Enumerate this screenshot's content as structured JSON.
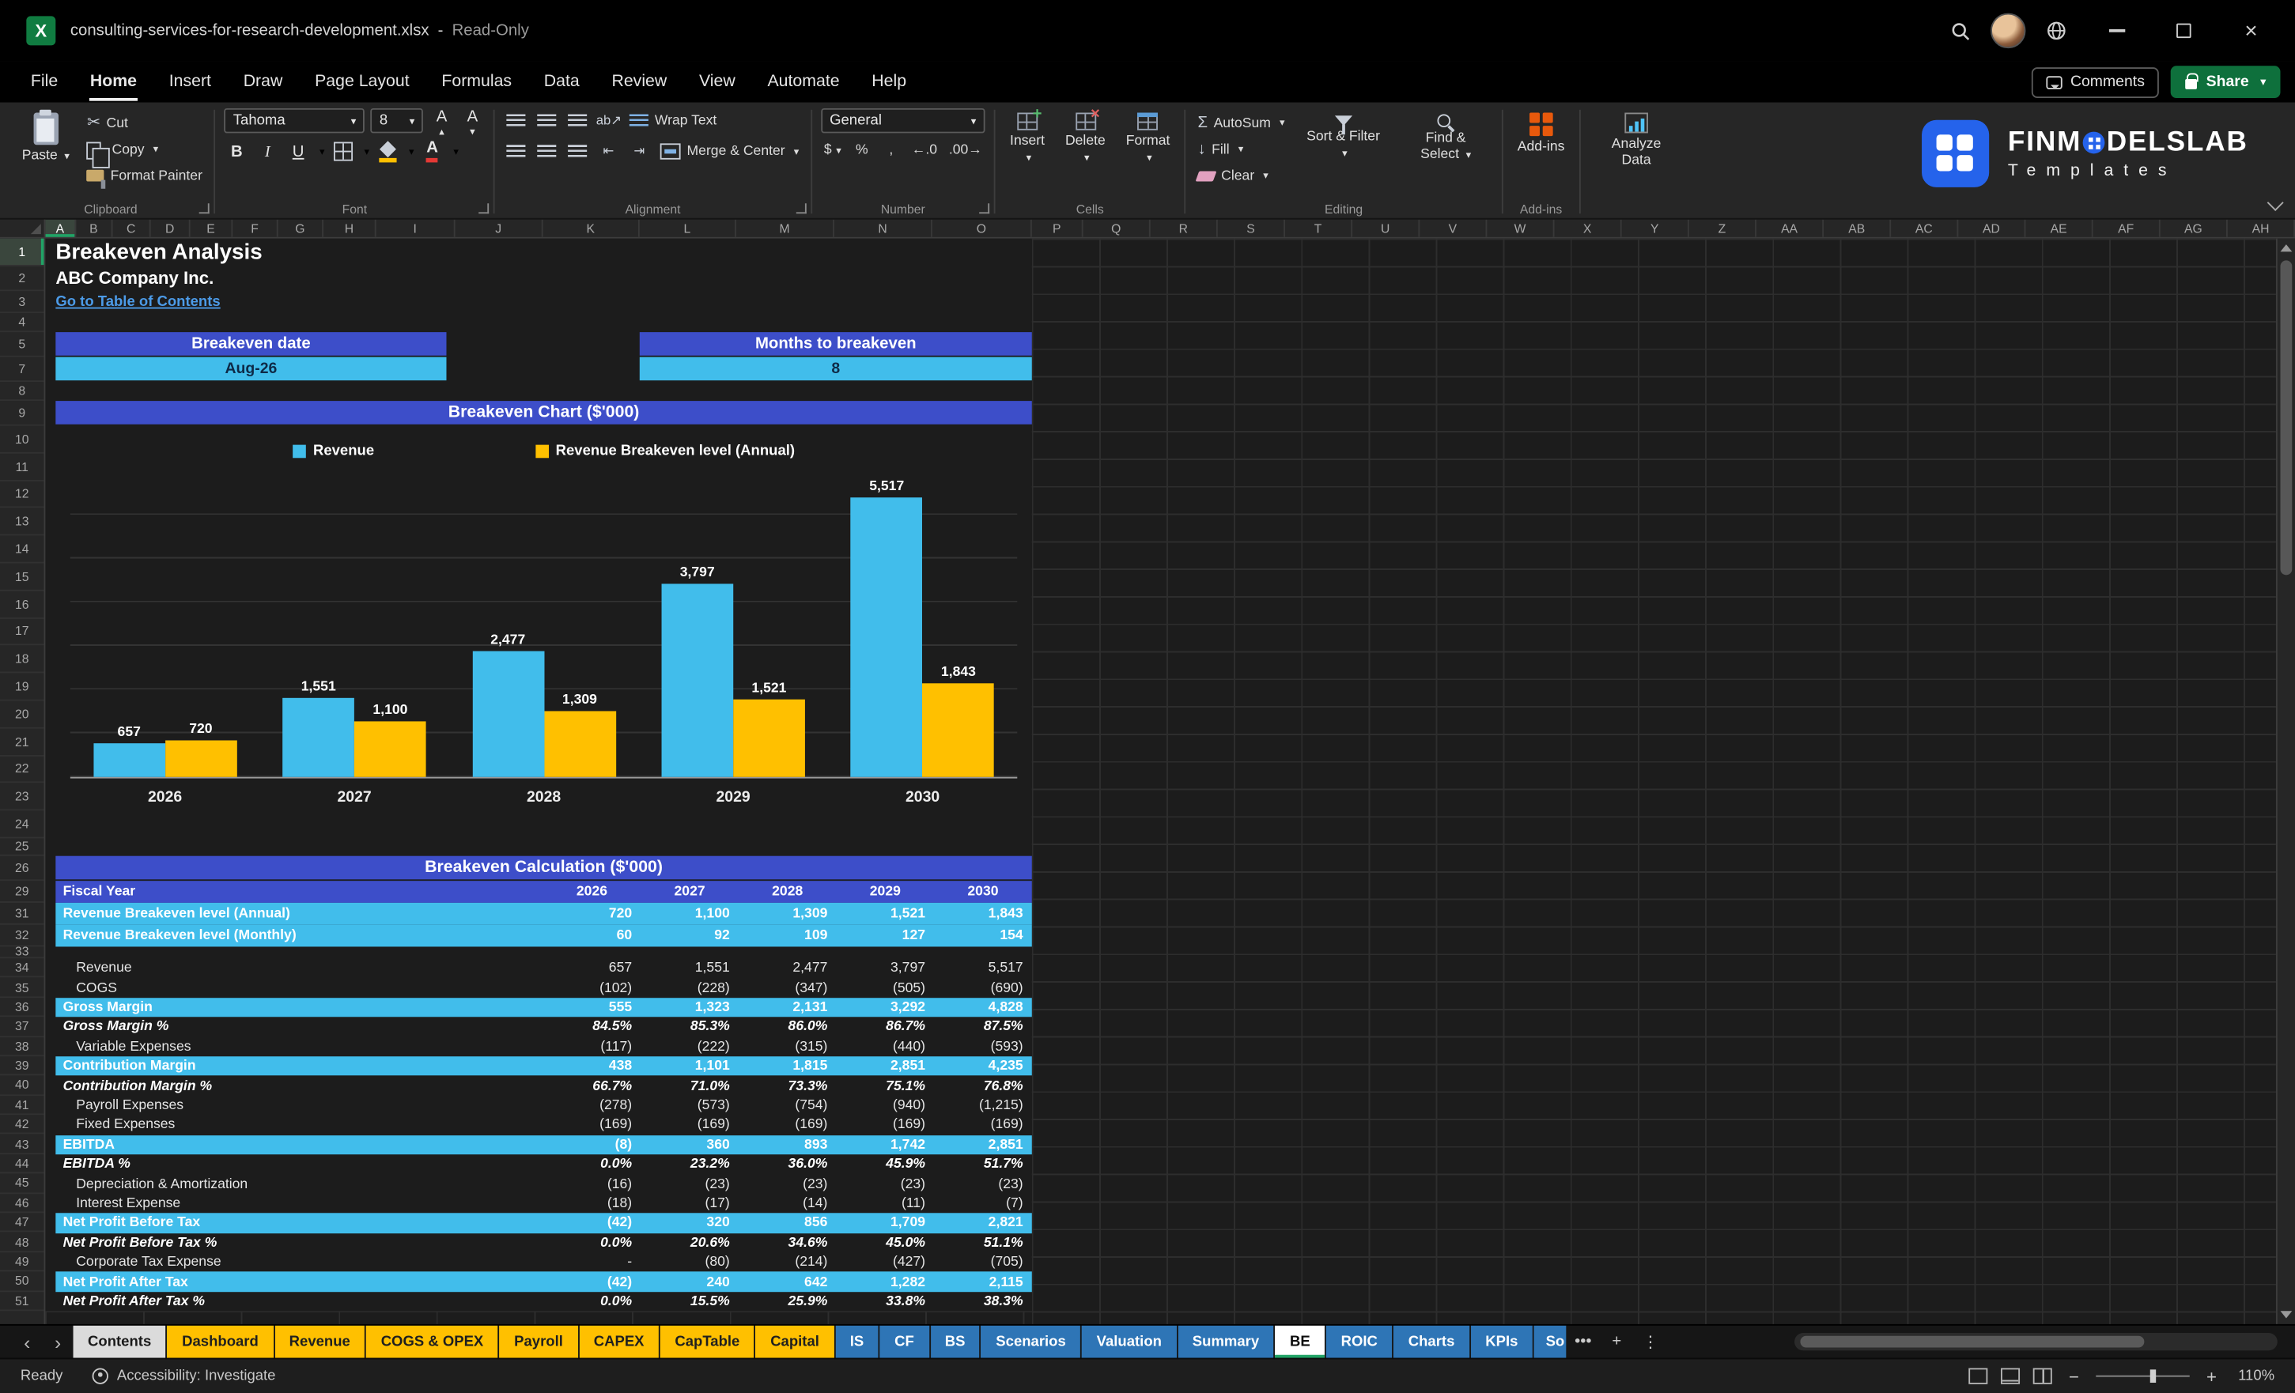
{
  "titlebar": {
    "filename": "consulting-services-for-research-development.xlsx",
    "sep": "-",
    "mode": "Read-Only"
  },
  "menubar": {
    "items": [
      "File",
      "Home",
      "Insert",
      "Draw",
      "Page Layout",
      "Formulas",
      "Data",
      "Review",
      "View",
      "Automate",
      "Help"
    ],
    "active": "Home",
    "comments_label": "Comments",
    "share_label": "Share"
  },
  "ribbon": {
    "paste": "Paste",
    "cut": "Cut",
    "copy": "Copy",
    "format_painter": "Format Painter",
    "font_name": "Tahoma",
    "font_size": "8",
    "wrap_text": "Wrap Text",
    "merge_center": "Merge & Center",
    "number_format": "General",
    "insert": "Insert",
    "delete": "Delete",
    "format": "Format",
    "autosum": "AutoSum",
    "fill": "Fill",
    "clear": "Clear",
    "sort_filter": "Sort & Filter",
    "find_select": "Find & Select",
    "addins": "Add-ins",
    "analyze_data": "Analyze Data",
    "groups": [
      "Clipboard",
      "Font",
      "Alignment",
      "Number",
      "Cells",
      "Editing",
      "Add-ins"
    ],
    "brand": {
      "name_pre": "FINM",
      "name_post": "DELSLAB",
      "subtitle": "Templates"
    }
  },
  "columns": [
    {
      "l": "A",
      "w": 21
    },
    {
      "l": "B",
      "w": 25
    },
    {
      "l": "C",
      "w": 26
    },
    {
      "l": "D",
      "w": 27
    },
    {
      "l": "E",
      "w": 29
    },
    {
      "l": "F",
      "w": 31
    },
    {
      "l": "G",
      "w": 31
    },
    {
      "l": "H",
      "w": 36
    },
    {
      "l": "I",
      "w": 54
    },
    {
      "l": "J",
      "w": 60
    },
    {
      "l": "K",
      "w": 66
    },
    {
      "l": "L",
      "w": 66
    },
    {
      "l": "M",
      "w": 67
    },
    {
      "l": "N",
      "w": 67
    },
    {
      "l": "O",
      "w": 68
    },
    {
      "l": "P",
      "w": 35
    },
    {
      "l": "Q",
      "w": 46
    },
    {
      "l": "R",
      "w": 46
    },
    {
      "l": "S",
      "w": 46
    },
    {
      "l": "T",
      "w": 46
    },
    {
      "l": "U",
      "w": 46
    },
    {
      "l": "V",
      "w": 46
    },
    {
      "l": "W",
      "w": 46
    },
    {
      "l": "X",
      "w": 46
    },
    {
      "l": "Y",
      "w": 46
    },
    {
      "l": "Z",
      "w": 46
    },
    {
      "l": "AA",
      "w": 46
    },
    {
      "l": "AB",
      "w": 46
    },
    {
      "l": "AC",
      "w": 46
    },
    {
      "l": "AD",
      "w": 46
    },
    {
      "l": "AE",
      "w": 46
    },
    {
      "l": "AF",
      "w": 46
    },
    {
      "l": "AG",
      "w": 46
    },
    {
      "l": "AH",
      "w": 46
    }
  ],
  "row_numbers": [
    1,
    2,
    3,
    4,
    5,
    7,
    8,
    9,
    10,
    11,
    12,
    13,
    14,
    15,
    16,
    17,
    18,
    19,
    20,
    21,
    22,
    23,
    24,
    25,
    26,
    29,
    31,
    32,
    33,
    34,
    35,
    36,
    37,
    38,
    39,
    40,
    41,
    42,
    43,
    44,
    45,
    46,
    47,
    48,
    49,
    50,
    51
  ],
  "sheet": {
    "title": "Breakeven Analysis",
    "company": "ABC Company Inc.",
    "link": "Go to Table of Contents",
    "breakeven_date_label": "Breakeven date",
    "breakeven_date_value": "Aug-26",
    "months_label": "Months to breakeven",
    "months_value": "8",
    "chart_title": "Breakeven Chart ($'000)",
    "calc_title": "Breakeven Calculation ($'000)"
  },
  "chart_data": {
    "type": "bar",
    "title": "Breakeven Chart ($'000)",
    "categories": [
      "2026",
      "2027",
      "2028",
      "2029",
      "2030"
    ],
    "series": [
      {
        "name": "Revenue",
        "color": "#41BDEB",
        "values": [
          657,
          1551,
          2477,
          3797,
          5517
        ]
      },
      {
        "name": "Revenue Breakeven level (Annual)",
        "color": "#FFC000",
        "values": [
          720,
          1100,
          1309,
          1521,
          1843
        ]
      }
    ],
    "value_labels": [
      [
        "657",
        "1,551",
        "2,477",
        "3,797",
        "5,517"
      ],
      [
        "720",
        "1,100",
        "1,309",
        "1,521",
        "1,843"
      ]
    ],
    "ylim": [
      0,
      6000
    ],
    "legend_position": "top",
    "gridlines": true
  },
  "table": {
    "header": [
      "Fiscal Year",
      "2026",
      "2027",
      "2028",
      "2029",
      "2030"
    ],
    "top_rows": [
      {
        "label": "Revenue Breakeven level (Annual)",
        "type": "band",
        "values": [
          "720",
          "1,100",
          "1,309",
          "1,521",
          "1,843"
        ]
      },
      {
        "label": "Revenue Breakeven level (Monthly)",
        "type": "band",
        "values": [
          "60",
          "92",
          "109",
          "127",
          "154"
        ]
      }
    ],
    "rows": [
      {
        "label": "Revenue",
        "type": "plain",
        "values": [
          "657",
          "1,551",
          "2,477",
          "3,797",
          "5,517"
        ]
      },
      {
        "label": "COGS",
        "type": "plain",
        "values": [
          "(102)",
          "(228)",
          "(347)",
          "(505)",
          "(690)"
        ]
      },
      {
        "label": "Gross Margin",
        "type": "band",
        "values": [
          "555",
          "1,323",
          "2,131",
          "3,292",
          "4,828"
        ]
      },
      {
        "label": "Gross Margin %",
        "type": "pct",
        "values": [
          "84.5%",
          "85.3%",
          "86.0%",
          "86.7%",
          "87.5%"
        ]
      },
      {
        "label": "Variable Expenses",
        "type": "plain",
        "values": [
          "(117)",
          "(222)",
          "(315)",
          "(440)",
          "(593)"
        ]
      },
      {
        "label": "Contribution Margin",
        "type": "band",
        "values": [
          "438",
          "1,101",
          "1,815",
          "2,851",
          "4,235"
        ]
      },
      {
        "label": "Contribution Margin %",
        "type": "pct",
        "values": [
          "66.7%",
          "71.0%",
          "73.3%",
          "75.1%",
          "76.8%"
        ]
      },
      {
        "label": "Payroll Expenses",
        "type": "plain",
        "values": [
          "(278)",
          "(573)",
          "(754)",
          "(940)",
          "(1,215)"
        ]
      },
      {
        "label": "Fixed Expenses",
        "type": "plain",
        "values": [
          "(169)",
          "(169)",
          "(169)",
          "(169)",
          "(169)"
        ]
      },
      {
        "label": "EBITDA",
        "type": "band",
        "values": [
          "(8)",
          "360",
          "893",
          "1,742",
          "2,851"
        ]
      },
      {
        "label": "EBITDA %",
        "type": "pct",
        "values": [
          "0.0%",
          "23.2%",
          "36.0%",
          "45.9%",
          "51.7%"
        ]
      },
      {
        "label": "Depreciation & Amortization",
        "type": "plain",
        "values": [
          "(16)",
          "(23)",
          "(23)",
          "(23)",
          "(23)"
        ]
      },
      {
        "label": "Interest Expense",
        "type": "plain",
        "values": [
          "(18)",
          "(17)",
          "(14)",
          "(11)",
          "(7)"
        ]
      },
      {
        "label": "Net Profit Before Tax",
        "type": "band",
        "values": [
          "(42)",
          "320",
          "856",
          "1,709",
          "2,821"
        ]
      },
      {
        "label": "Net Profit Before Tax %",
        "type": "pct",
        "values": [
          "0.0%",
          "20.6%",
          "34.6%",
          "45.0%",
          "51.1%"
        ]
      },
      {
        "label": "Corporate Tax Expense",
        "type": "plain",
        "values": [
          "-",
          "(80)",
          "(214)",
          "(427)",
          "(705)"
        ]
      },
      {
        "label": "Net Profit After Tax",
        "type": "band",
        "values": [
          "(42)",
          "240",
          "642",
          "1,282",
          "2,115"
        ]
      },
      {
        "label": "Net Profit After Tax %",
        "type": "pct",
        "values": [
          "0.0%",
          "15.5%",
          "25.9%",
          "33.8%",
          "38.3%"
        ]
      }
    ]
  },
  "tabs": {
    "items": [
      {
        "label": "Contents",
        "type": "gray"
      },
      {
        "label": "Dashboard",
        "type": "yellow"
      },
      {
        "label": "Revenue",
        "type": "yellow"
      },
      {
        "label": "COGS & OPEX",
        "type": "yellow"
      },
      {
        "label": "Payroll",
        "type": "yellow"
      },
      {
        "label": "CAPEX",
        "type": "yellow"
      },
      {
        "label": "CapTable",
        "type": "yellow"
      },
      {
        "label": "Capital",
        "type": "yellow"
      },
      {
        "label": "IS",
        "type": "blue"
      },
      {
        "label": "CF",
        "type": "blue"
      },
      {
        "label": "BS",
        "type": "blue"
      },
      {
        "label": "Scenarios",
        "type": "blue"
      },
      {
        "label": "Valuation",
        "type": "blue"
      },
      {
        "label": "Summary",
        "type": "blue"
      },
      {
        "label": "BE",
        "type": "active"
      },
      {
        "label": "ROIC",
        "type": "blue"
      },
      {
        "label": "Charts",
        "type": "blue"
      },
      {
        "label": "KPIs",
        "type": "blue"
      },
      {
        "label": "So",
        "type": "blue",
        "truncated": true
      }
    ],
    "active": "BE",
    "more": "•••",
    "add": "+",
    "menu": "⋮"
  },
  "statusbar": {
    "ready": "Ready",
    "accessibility": "Accessibility: Investigate",
    "zoom": "110%"
  }
}
